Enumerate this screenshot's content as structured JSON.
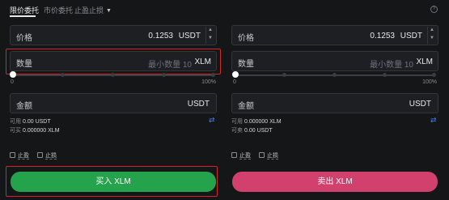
{
  "tabs": {
    "limit": "限价委托",
    "market": "市价委托",
    "tpsl": "止盈止损"
  },
  "buy": {
    "price_label": "价格",
    "price_value": "0.1253",
    "price_unit": "USDT",
    "qty_label": "数量",
    "qty_placeholder": "最小数量 10",
    "qty_unit": "XLM",
    "slider_min": "0",
    "slider_max": "100%",
    "slider_percent": 0,
    "amount_label": "金额",
    "amount_unit": "USDT",
    "available_label": "可用",
    "available_value": "0.00 USDT",
    "can_buy_label": "可买",
    "can_buy_value": "0.000000 XLM",
    "tp_label": "止盈",
    "sl_label": "止损",
    "button": "买入 XLM"
  },
  "sell": {
    "price_label": "价格",
    "price_value": "0.1253",
    "price_unit": "USDT",
    "qty_label": "数量",
    "qty_placeholder": "最小数量 10",
    "qty_unit": "XLM",
    "slider_min": "0",
    "slider_max": "100%",
    "slider_percent": 0,
    "amount_label": "金额",
    "amount_unit": "USDT",
    "available_label": "可用",
    "available_value": "0.000000 XLM",
    "can_sell_label": "可卖",
    "can_sell_value": "0.00 USDT",
    "tp_label": "止盈",
    "sl_label": "止损",
    "button": "卖出 XLM"
  },
  "colors": {
    "buy": "#25a34c",
    "sell": "#d2406d",
    "highlight": "#d3262b",
    "link": "#3b82f6"
  },
  "icons": {
    "dropdown": "chevron-down-icon",
    "help": "help-circle-icon",
    "swap": "swap-arrows-icon",
    "stepper": "stepper-arrows-icon"
  }
}
